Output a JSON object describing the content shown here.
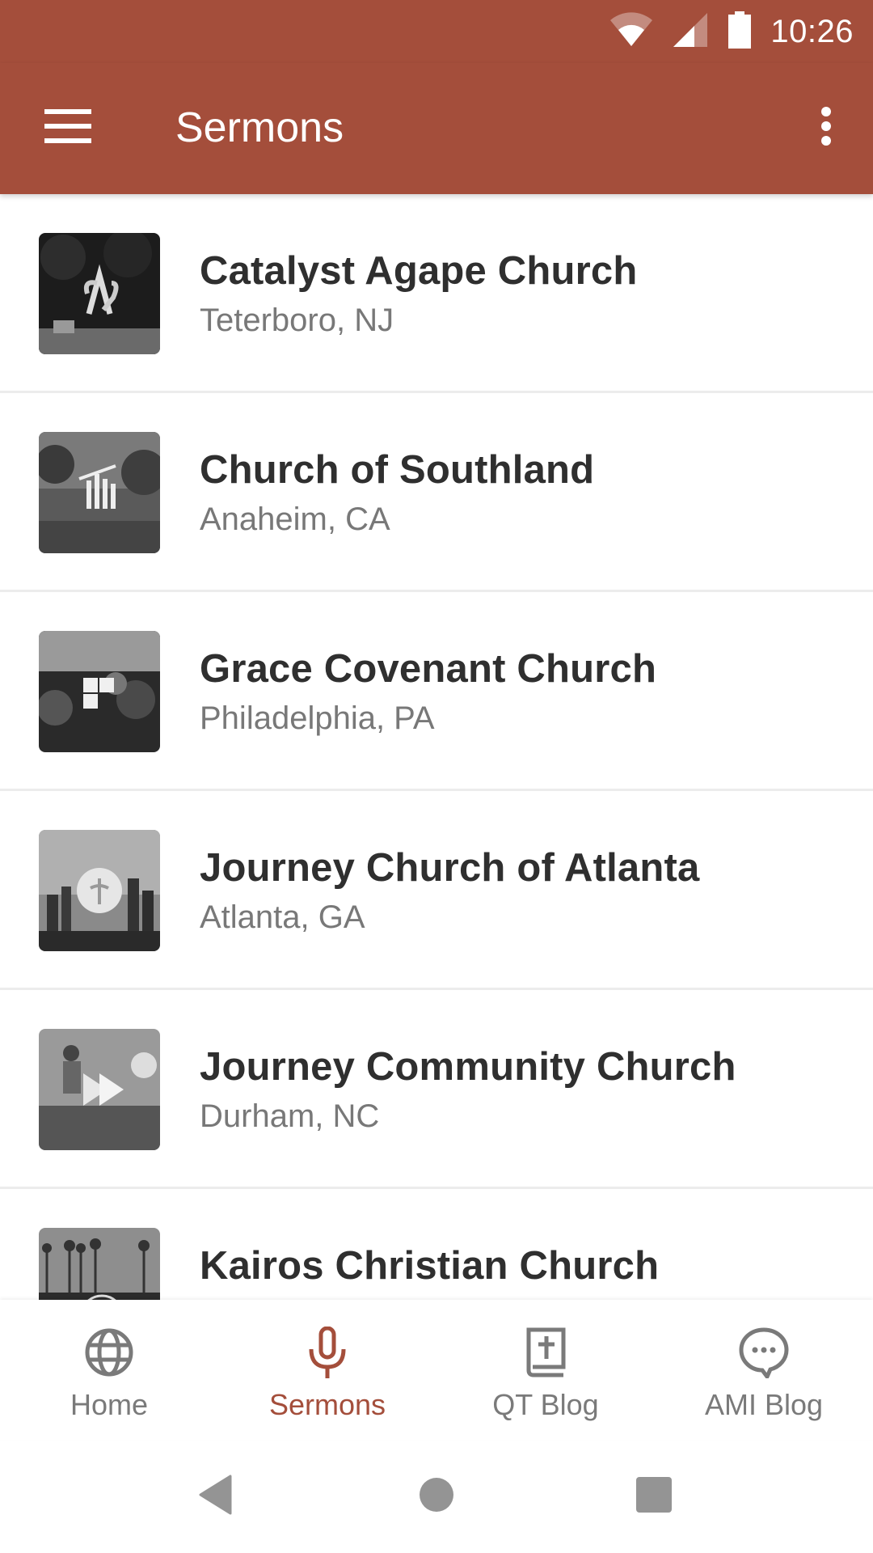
{
  "status_bar": {
    "time": "10:26",
    "icons": [
      "wifi-icon",
      "cell-signal-icon",
      "battery-icon"
    ]
  },
  "app_bar": {
    "title": "Sermons",
    "menu_icon": "hamburger-menu-icon",
    "overflow_icon": "more-vert-icon"
  },
  "churches": [
    {
      "name": "Catalyst Agape Church",
      "location": "Teterboro, NJ"
    },
    {
      "name": "Church of Southland",
      "location": "Anaheim, CA"
    },
    {
      "name": "Grace Covenant Church",
      "location": "Philadelphia, PA"
    },
    {
      "name": "Journey Church of Atlanta",
      "location": "Atlanta, GA"
    },
    {
      "name": "Journey Community Church",
      "location": "Durham, NC"
    },
    {
      "name": "Kairos Christian Church",
      "location": ""
    }
  ],
  "bottom_nav": {
    "items": [
      {
        "label": "Home",
        "icon": "globe-icon",
        "active": false
      },
      {
        "label": "Sermons",
        "icon": "microphone-icon",
        "active": true
      },
      {
        "label": "QT Blog",
        "icon": "bible-icon",
        "active": false
      },
      {
        "label": "AMI Blog",
        "icon": "chat-bubble-icon",
        "active": false
      }
    ]
  },
  "system_nav": {
    "buttons": [
      "back",
      "home",
      "recents"
    ]
  },
  "colors": {
    "primary": "#a44e3b",
    "nav_inactive": "#7a7a7a",
    "title_text": "#2f2f2f",
    "subtitle_text": "#787878"
  }
}
